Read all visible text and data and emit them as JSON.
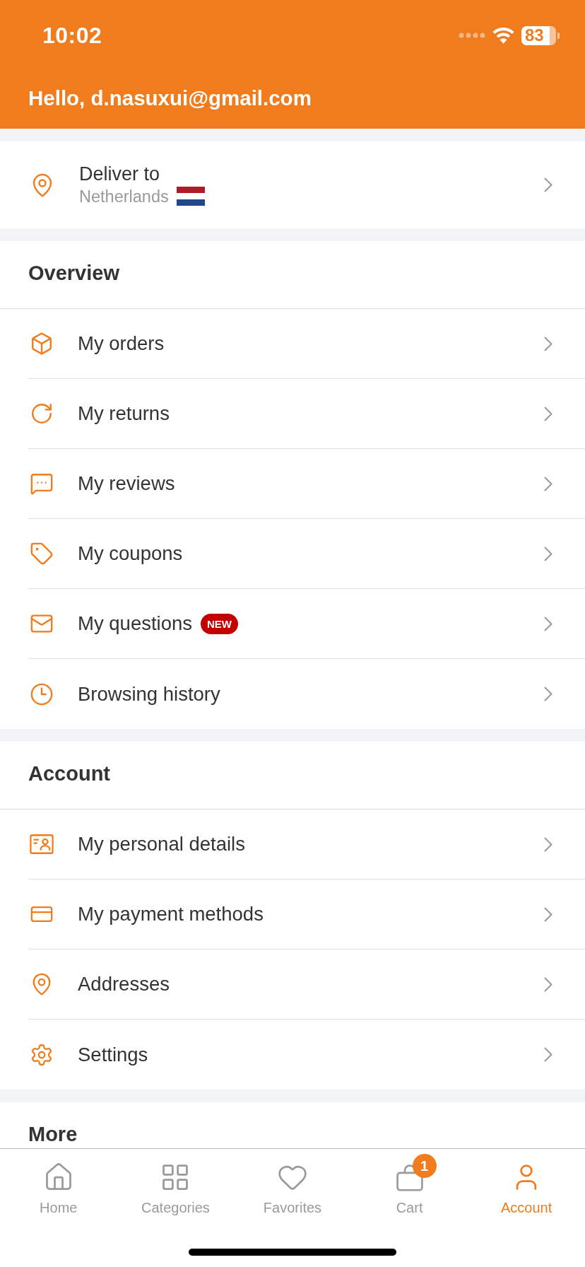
{
  "status_bar": {
    "time": "10:02",
    "battery": "83"
  },
  "header": {
    "greeting": "Hello, d.nasuxui@gmail.com"
  },
  "delivery": {
    "label": "Deliver to",
    "country": "Netherlands"
  },
  "sections": [
    {
      "title": "Overview",
      "items": [
        {
          "label": "My orders"
        },
        {
          "label": "My returns"
        },
        {
          "label": "My reviews"
        },
        {
          "label": "My coupons"
        },
        {
          "label": "My questions",
          "badge": "NEW"
        },
        {
          "label": "Browsing history"
        }
      ]
    },
    {
      "title": "Account",
      "items": [
        {
          "label": "My personal details"
        },
        {
          "label": "My payment methods"
        },
        {
          "label": "Addresses"
        },
        {
          "label": "Settings"
        }
      ]
    },
    {
      "title": "More"
    }
  ],
  "tab_bar": [
    {
      "label": "Home",
      "selected": false
    },
    {
      "label": "Categories",
      "selected": false
    },
    {
      "label": "Favorites",
      "selected": false
    },
    {
      "label": "Cart",
      "selected": false,
      "badge": "1"
    },
    {
      "label": "Account",
      "selected": true
    }
  ]
}
